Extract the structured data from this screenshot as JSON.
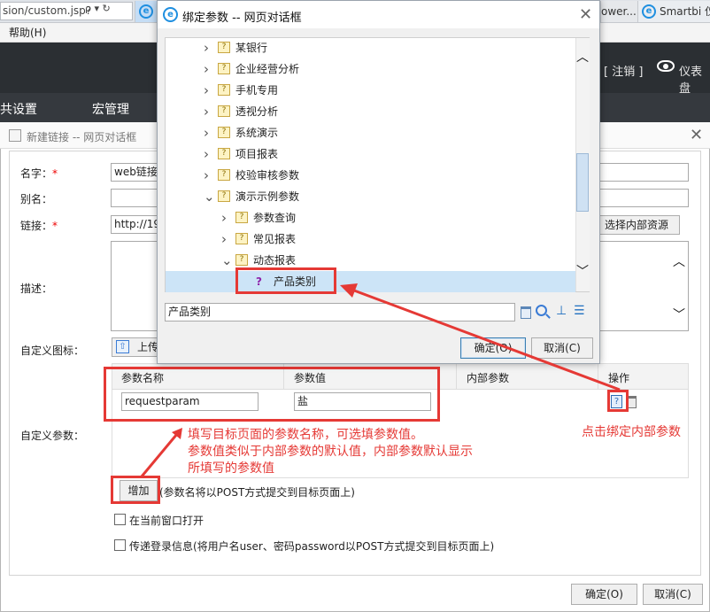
{
  "browser": {
    "url": "sion/custom.jsp?",
    "url_buttons": "ρ ▾ ↻",
    "tabs": [
      {
        "label": "",
        "active": true
      },
      {
        "label": "ower...",
        "active": false
      },
      {
        "label": "Smartbi 仪",
        "active": false
      }
    ],
    "menu_help": "帮助(H)"
  },
  "header": {
    "logout": "[ 注销 ]",
    "dashboard": "仪表盘"
  },
  "nav": {
    "item1": "共设置",
    "item2": "宏管理"
  },
  "link_dialog": {
    "title": "新建链接 -- 网页对话框",
    "name_label": "名字：",
    "required_mark": "*",
    "name_value": "web链接",
    "alias_label": "别名：",
    "link_label": "链接：",
    "link_value": "http://19",
    "choose_internal_btn": "选择内部资源",
    "desc_label": "描述：",
    "icon_label": "自定义图标：",
    "upload_btn": "上传",
    "params_label": "自定义参数：",
    "table_headers": [
      "参数名称",
      "参数值",
      "内部参数",
      "操作"
    ],
    "param_name_value": "requestparam",
    "param_value_value": "盐",
    "add_btn": "增加",
    "add_hint": "(参数名将以POST方式提交到目标页面上)",
    "open_current_window": "在当前窗口打开",
    "pass_login": "传递登录信息(将用户名user、密码password以POST方式提交到目标页面上)",
    "ok_btn": "确定(O)",
    "cancel_btn": "取消(C)"
  },
  "bind_dialog": {
    "title": "绑定参数 -- 网页对话框",
    "tree": [
      {
        "label": "某银行",
        "expanded": false,
        "level": 0
      },
      {
        "label": "企业经营分析",
        "expanded": false,
        "level": 0
      },
      {
        "label": "手机专用",
        "expanded": false,
        "level": 0
      },
      {
        "label": "透视分析",
        "expanded": false,
        "level": 0
      },
      {
        "label": "系统演示",
        "expanded": false,
        "level": 0
      },
      {
        "label": "项目报表",
        "expanded": false,
        "level": 0
      },
      {
        "label": "校验审核参数",
        "expanded": false,
        "level": 0
      },
      {
        "label": "演示示例参数",
        "expanded": true,
        "level": 0
      },
      {
        "label": "参数查询",
        "expanded": false,
        "level": 1
      },
      {
        "label": "常见报表",
        "expanded": false,
        "level": 1
      },
      {
        "label": "动态报表",
        "expanded": true,
        "level": 1
      }
    ],
    "selected_item": "产品类别",
    "search_value": "产品类别",
    "ok_btn": "确定(O)",
    "cancel_btn": "取消(C)"
  },
  "annotations": {
    "fill_note": [
      "填写目标页面的参数名称，可选填参数值。",
      "参数值类似于内部参数的默认值，内部参数默认显示",
      "所填写的参数值"
    ],
    "bind_note": "点击绑定内部参数"
  },
  "colors": {
    "annotation": "#e53935",
    "selection": "#cce4f7",
    "dark_header": "#2b2f33"
  }
}
